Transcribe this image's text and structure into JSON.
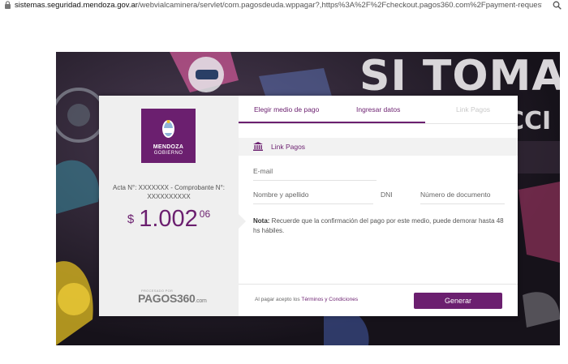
{
  "browser": {
    "url_domain": "sistemas.seguridad.mendoza.gov.ar",
    "url_path": "/webvialcaminera/servlet/com.pagosdeuda.wppagar?,https%3A%2F%2Fcheckout.pagos360.com%2Fpayment-request%...",
    "lock_icon": "lock-icon",
    "search_icon": "search-icon"
  },
  "background": {
    "headline": "SI TOMA",
    "sub_headline": "CCI"
  },
  "merchant": {
    "logo_line1": "MENDOZA",
    "logo_line2": "GOBIERNO",
    "reference": "Acta N°: XXXXXXX - Comprobante N°: XXXXXXXXXX",
    "currency": "$",
    "amount_integer": "1.002",
    "amount_decimals": "06",
    "powered_small": "PROCESADO POR",
    "powered_brand": "PAGOS360",
    "powered_suffix": ".com"
  },
  "tabs": [
    {
      "label": "Elegir medio de pago",
      "state": "done"
    },
    {
      "label": "Ingresar datos",
      "state": "active"
    },
    {
      "label": "Link Pagos",
      "state": "disabled"
    }
  ],
  "payment_method": {
    "icon": "bank-icon",
    "label": "Link Pagos"
  },
  "form": {
    "email_placeholder": "E-mail",
    "name_placeholder": "Nombre y apellido",
    "doc_type": "DNI",
    "doc_number_placeholder": "Número de documento"
  },
  "note": {
    "prefix": "Nota:",
    "text": " Recuerde que la confirmación del pago por este medio, puede demorar hasta 48 hs hábiles."
  },
  "footer": {
    "terms_prefix": "Al pagar acepto los ",
    "terms_link": "Términos y Condiciones",
    "generate_button": "Generar"
  },
  "colors": {
    "brand": "#6b1f6f",
    "background_dark": "#1f1a22"
  }
}
